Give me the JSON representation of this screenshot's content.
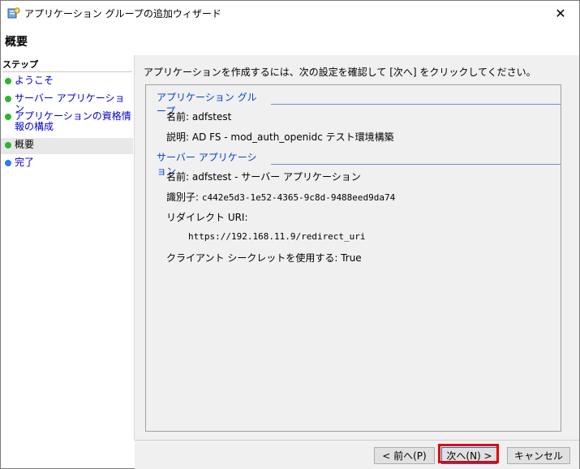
{
  "window": {
    "title": "アプリケーション グループの追加ウィザード",
    "close_glyph": "✕",
    "icon": "server-wizard-icon"
  },
  "header": {
    "title": "概要"
  },
  "sidebar": {
    "steps_label": "ステップ",
    "items": [
      {
        "label": "ようこそ",
        "status": "done",
        "color": "#2db52d"
      },
      {
        "label": "サーバー アプリケーション",
        "status": "done",
        "color": "#2db52d"
      },
      {
        "label": "アプリケーションの資格情報の構成",
        "status": "done",
        "color": "#2db52d"
      },
      {
        "label": "概要",
        "status": "current",
        "color": "#2db52d"
      },
      {
        "label": "完了",
        "status": "pending",
        "color": "#2b7de9"
      }
    ]
  },
  "main": {
    "instruction": "アプリケーションを作成するには、次の設定を確認して [次へ] をクリックしてください。",
    "app_group": {
      "section_title": "アプリケーション グループ",
      "name": "名前: adfstest",
      "description": "説明: AD FS - mod_auth_openidc テスト環境構築"
    },
    "server_app": {
      "section_title": "サーバー アプリケーション",
      "name": "名前: adfstest - サーバー アプリケーション",
      "identifier_label": "識別子:",
      "identifier_value": "c442e5d3-1e52-4365-9c8d-9488eed9da74",
      "redirect_label": "リダイレクト URI:",
      "redirect_uri": "https://192.168.11.9/redirect_uri",
      "client_secret": "クライアント シークレットを使用する: True"
    }
  },
  "footer": {
    "back_label": "< 前へ(P)",
    "next_label": "次へ(N) >",
    "cancel_label": "キャンセル",
    "highlight_color": "#e60000"
  }
}
